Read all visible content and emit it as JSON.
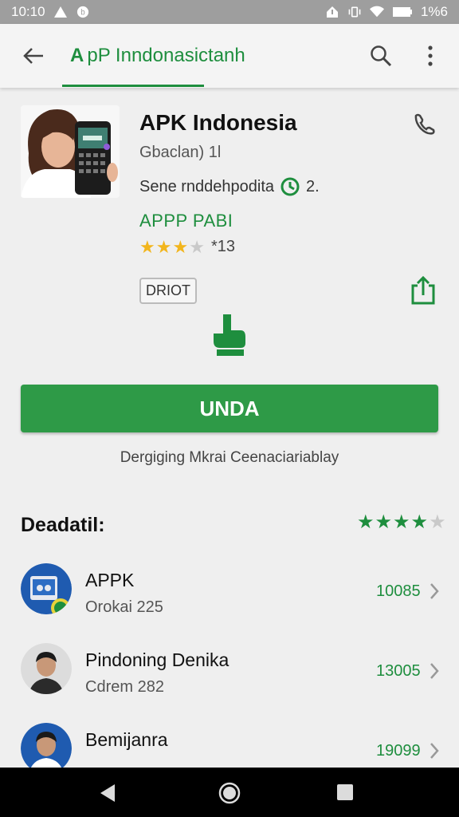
{
  "status_bar": {
    "time": "10:10",
    "battery": "1%6"
  },
  "app_bar": {
    "title_logo": "A",
    "title": "pP Inndonasictanh"
  },
  "app": {
    "name": "APK Indonesia",
    "subtitle": "Gbaclan) 1l",
    "meta": "Sene rnddehpodita",
    "meta_suffix": "2.",
    "tag_label": "APPP PABI",
    "rating_text": "*13",
    "chip_label": "DRIOT"
  },
  "install": {
    "button_label": "UNDA",
    "note": "Dergiging Mkrai Ceenaciariablay"
  },
  "section": {
    "title": "Deadatil:"
  },
  "list": [
    {
      "title": "APPK",
      "subtitle": "Orokai 225",
      "count": "10085"
    },
    {
      "title": "Pindoning Denika",
      "subtitle": "Cdrem 282",
      "count": "13005"
    },
    {
      "title": "Bemijanra",
      "subtitle": "",
      "count": "19099"
    }
  ],
  "colors": {
    "accent": "#1e8e3e",
    "button": "#2e9a47",
    "star": "#f2b51c",
    "status_bar": "#9e9e9e"
  }
}
